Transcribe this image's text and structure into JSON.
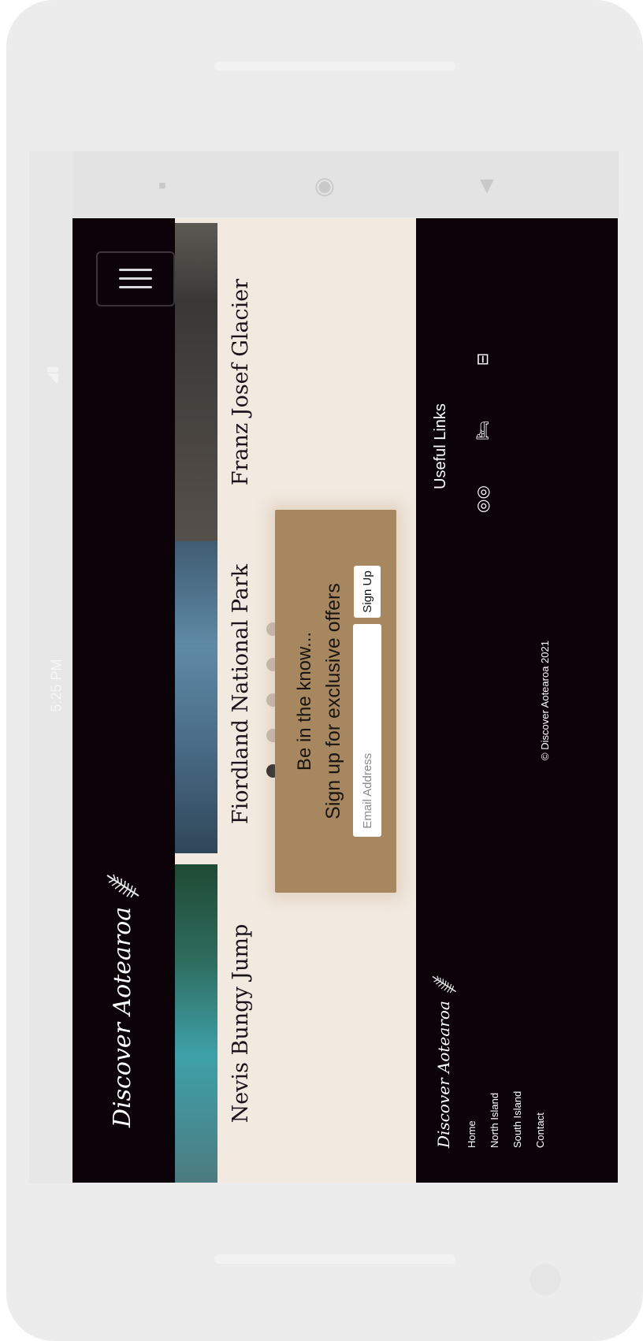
{
  "status_bar": {
    "time": "5:25 PM"
  },
  "header": {
    "brand": "Discover Aotearoa"
  },
  "cards": [
    {
      "title": "Nevis Bungy Jump"
    },
    {
      "title": "Fiordland National Park"
    },
    {
      "title": "Franz Josef Glacier"
    }
  ],
  "carousel": {
    "pages": 5,
    "active": 1
  },
  "newsletter": {
    "headline": "Be in the know...",
    "subline": "Sign up for exclusive offers",
    "email_placeholder": "Email Address",
    "button_label": "Sign Up"
  },
  "footer": {
    "brand": "Discover Aotearoa",
    "links": [
      "Home",
      "North Island",
      "South Island",
      "Contact"
    ],
    "copyright": "© Discover Aotearoa 2021",
    "useful_title": "Useful Links",
    "useful_icons": [
      "tripadvisor-icon",
      "hotel-bed-icon",
      "car-icon"
    ]
  },
  "colors": {
    "page_bg": "#f2e9e0",
    "header_bg": "#0b0307",
    "newsletter_bg": "#a7875f",
    "dot_active": "#2a2a2a",
    "dot_inactive": "#c7bcb2"
  }
}
